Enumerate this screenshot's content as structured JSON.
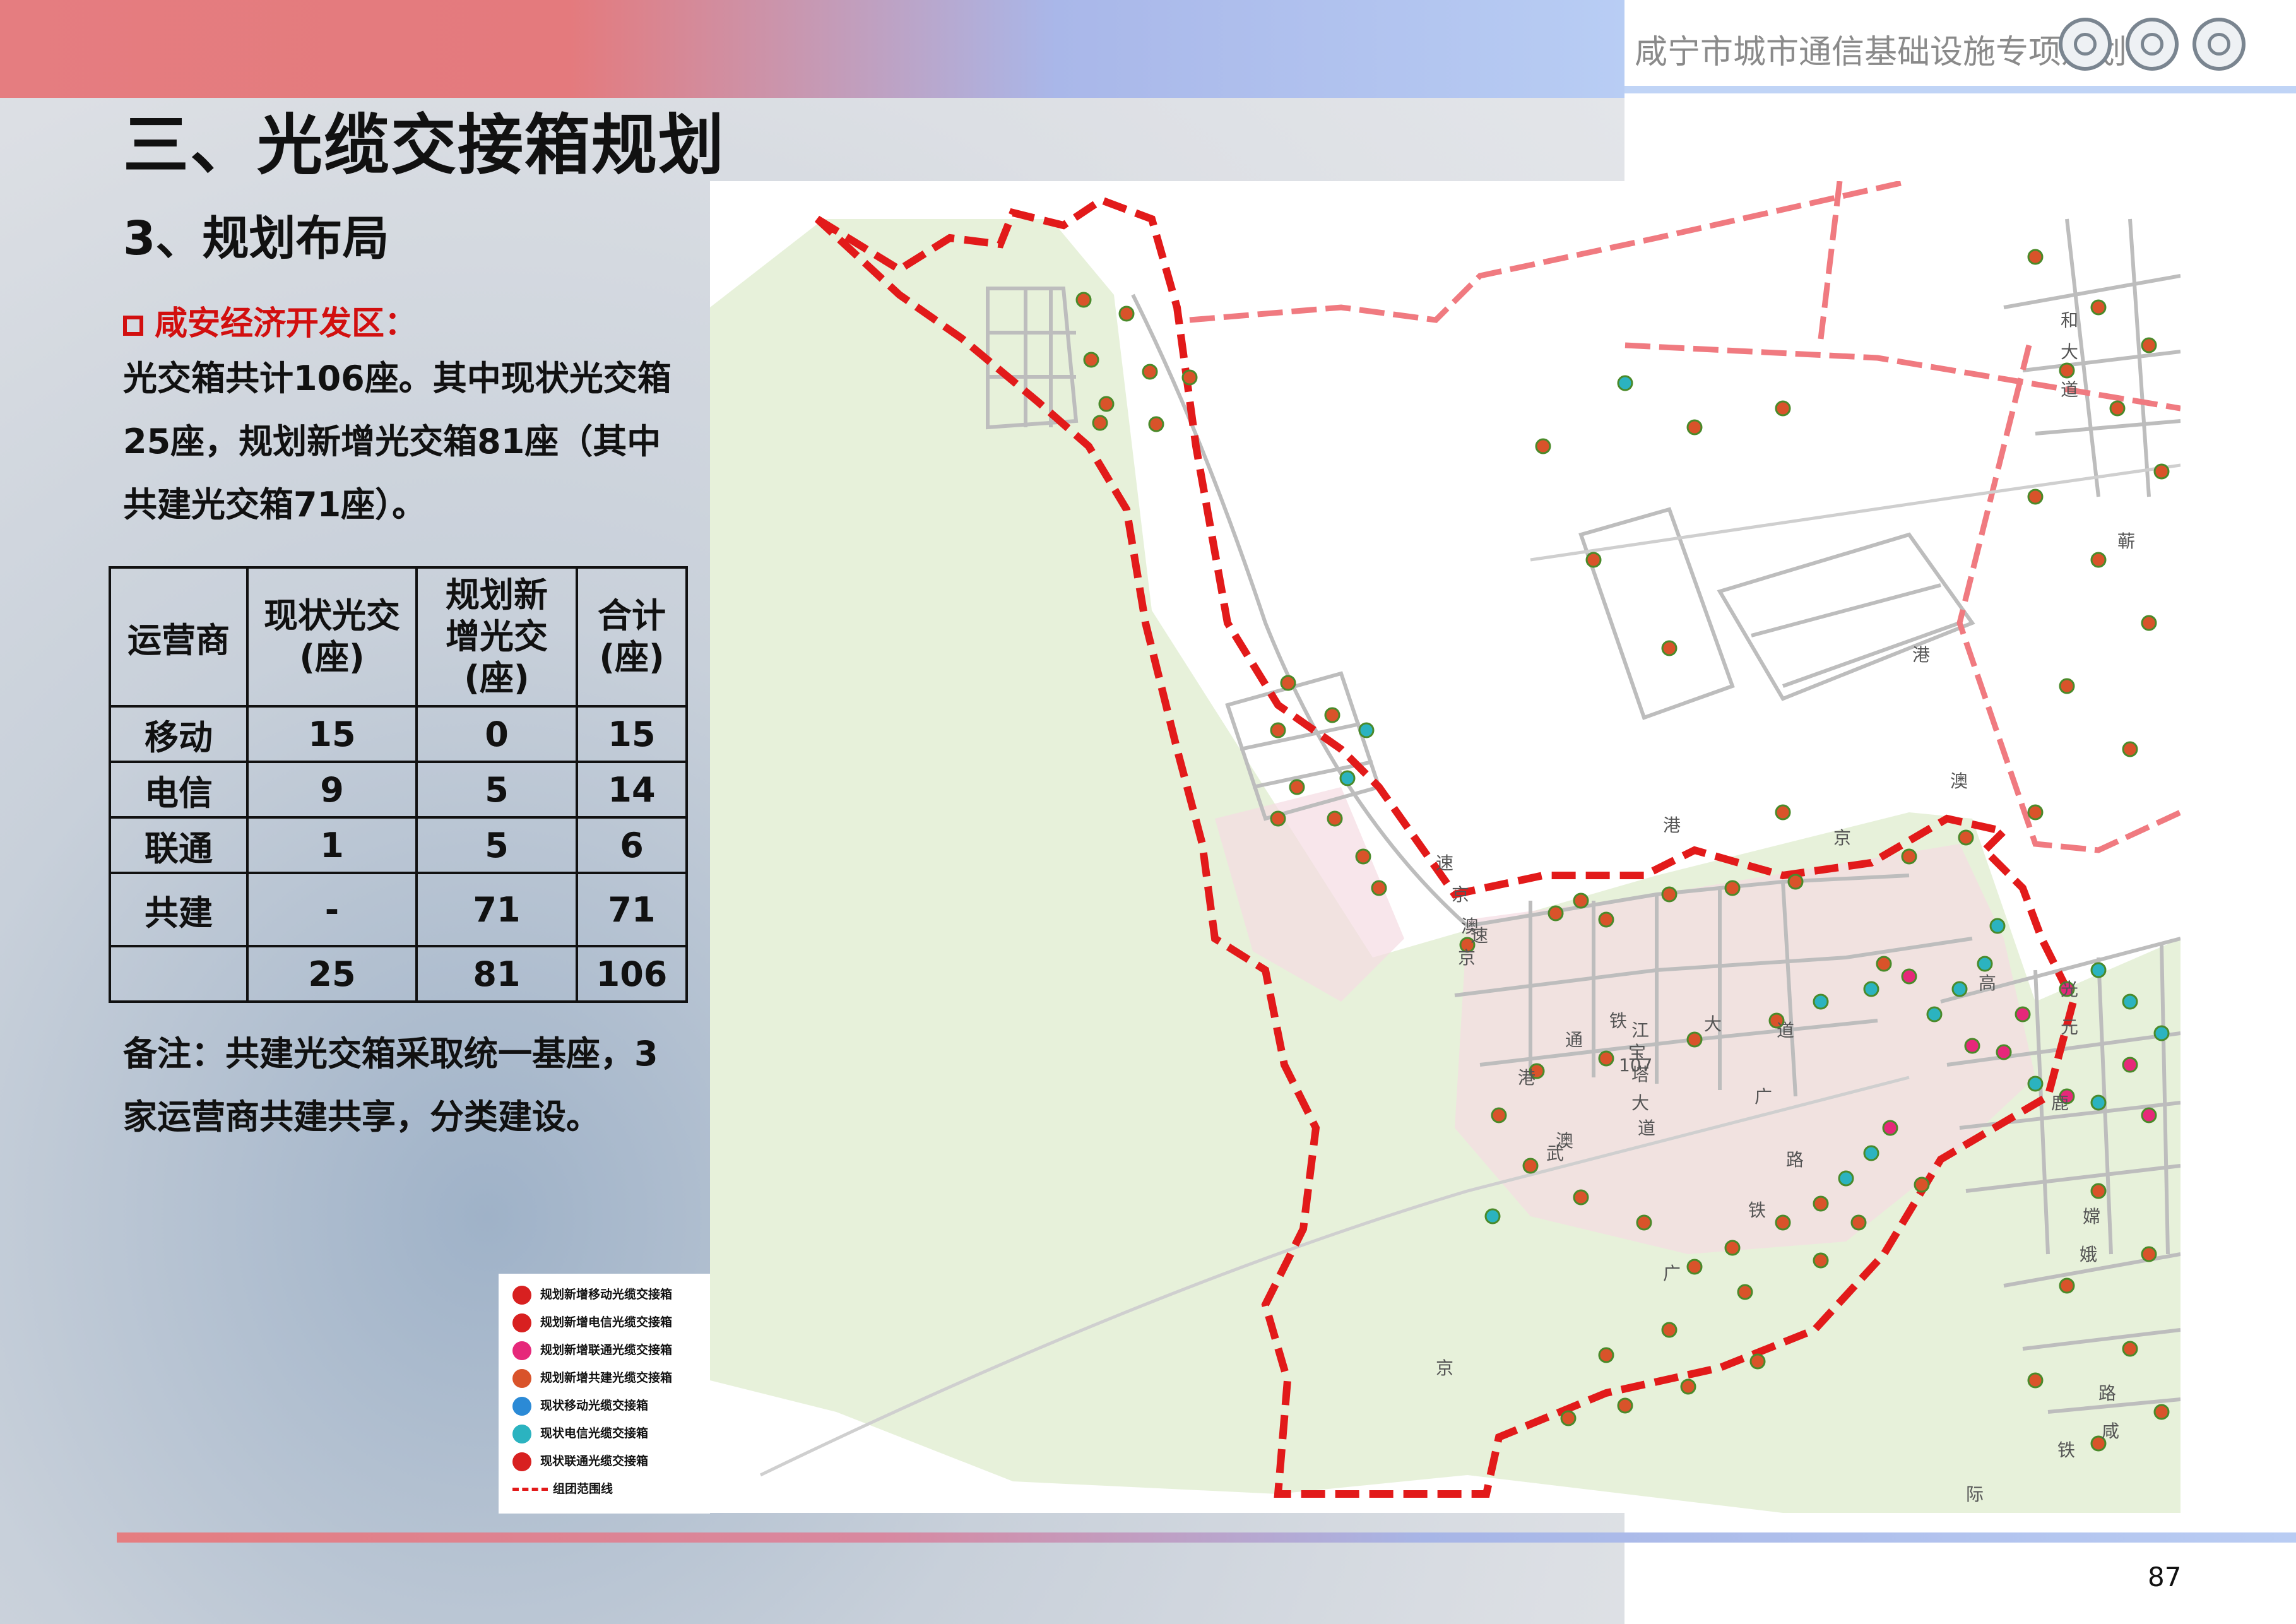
{
  "header": {
    "doc_title": "咸宁市城市通信基础设施专项规划",
    "logos": [
      "china-mobile-logo",
      "china-unicom-logo",
      "china-telecom-logo"
    ]
  },
  "section_title": "三、光缆交接箱规划",
  "sub_title": "3、规划布局",
  "zone_label": "咸安经济开发区：",
  "paragraph": [
    "光交箱共计106座。其中现状光交箱",
    "25座，规划新增光交箱81座（其中",
    "共建光交箱71座）。"
  ],
  "table": {
    "headers": [
      "运营商",
      "现状光交\n(座)",
      "规划新\n增光交\n(座)",
      "合计\n(座)"
    ],
    "rows": [
      [
        "移动",
        "15",
        "0",
        "15"
      ],
      [
        "电信",
        "9",
        "5",
        "14"
      ],
      [
        "联通",
        "1",
        "5",
        "6"
      ],
      [
        "共建",
        "-",
        "71",
        "71"
      ],
      [
        "",
        "25",
        "81",
        "106"
      ]
    ]
  },
  "note": [
    "备注：共建光交箱采取统一基座，3",
    "家运营商共建共享，分类建设。"
  ],
  "map": {
    "labels": [
      "通",
      "江",
      "大",
      "道",
      "广",
      "路",
      "武",
      "铁",
      "广",
      "京",
      "铁",
      "宝",
      "塔",
      "大",
      "道",
      "107",
      "速",
      "京",
      "港",
      "澳",
      "高",
      "港",
      "速",
      "京",
      "港",
      "澳",
      "京",
      "和",
      "大",
      "道",
      "蕲",
      "光",
      "元",
      "鹿",
      "嫦",
      "娥",
      "路",
      "咸",
      "铁",
      "际",
      "澳"
    ],
    "colors": {
      "boundary": "#e21a1a",
      "railway": "#f07a80",
      "road": "#c8c8c8",
      "greenland": "#dcebc8",
      "built": "#f5d9e2",
      "box_new_shared": "#d9532a",
      "box_existing_telecom": "#2bb3c0",
      "box_new_unicom": "#e6287a"
    }
  },
  "legend": [
    {
      "label": "规划新增移动光缆交接箱",
      "color": "#d82020",
      "icon": "box-marker-icon"
    },
    {
      "label": "规划新增电信光缆交接箱",
      "color": "#d82020",
      "icon": "box-marker-icon"
    },
    {
      "label": "规划新增联通光缆交接箱",
      "color": "#e6287a",
      "icon": "box-marker-icon"
    },
    {
      "label": "规划新增共建光缆交接箱",
      "color": "#d9532a",
      "icon": "box-marker-icon"
    },
    {
      "label": "现状移动光缆交接箱",
      "color": "#2b8ad6",
      "icon": "box-marker-icon"
    },
    {
      "label": "现状电信光缆交接箱",
      "color": "#2bb3c0",
      "icon": "box-marker-icon"
    },
    {
      "label": "现状联通光缆交接箱",
      "color": "#d82020",
      "icon": "box-marker-icon"
    },
    {
      "label": "组团范围线",
      "icon": "dashed-line-icon"
    }
  ],
  "page_number": "87"
}
